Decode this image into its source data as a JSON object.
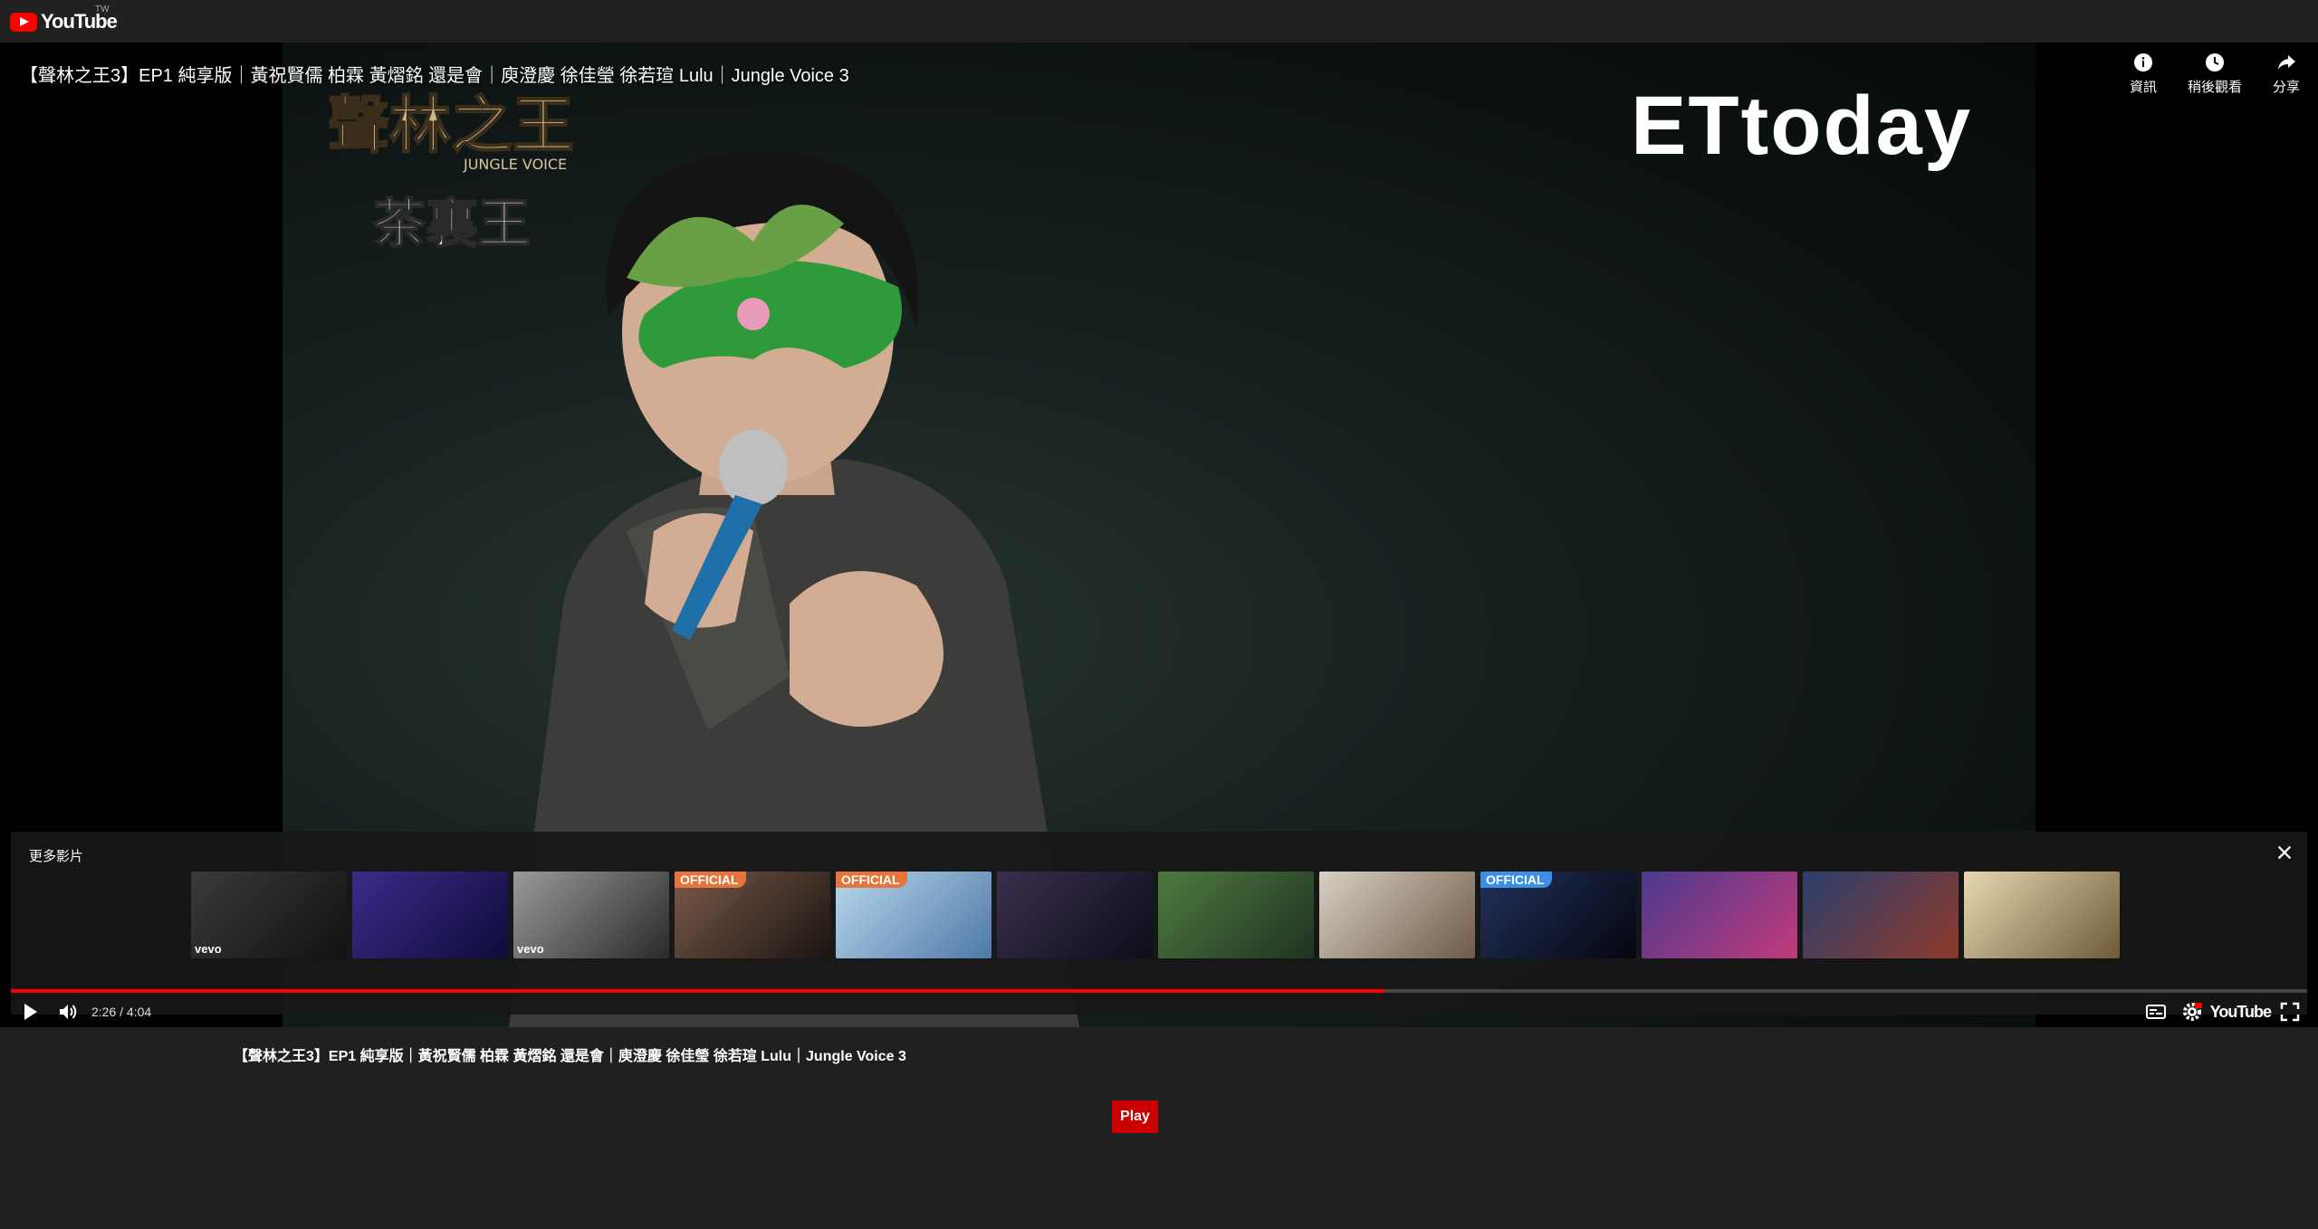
{
  "header": {
    "logo_text": "YouTube",
    "region_code": "TW"
  },
  "player": {
    "title": "【聲林之王3】EP1 純享版｜黃祝賢儒 柏霖 黃熠銘 還是會｜庾澄慶 徐佳瑩 徐若瑄 Lulu｜Jungle Voice 3",
    "actions": [
      {
        "label": "資訊",
        "icon": "info-icon"
      },
      {
        "label": "稍後觀看",
        "icon": "clock-icon"
      },
      {
        "label": "分享",
        "icon": "share-icon"
      }
    ],
    "overlays": {
      "show_logo_line1": "聲林之王",
      "show_logo_sub": "JUNGLE VOICE",
      "sponsor": "茶裏王",
      "brand": "ETtoday"
    },
    "more_videos": {
      "title": "更多影片",
      "thumbnails": [
        {
          "tag": "",
          "vevo": "vevo",
          "colors": [
            "#3a3a3a",
            "#111111"
          ]
        },
        {
          "tag": "",
          "vevo": "",
          "colors": [
            "#3b2c8a",
            "#0f0b3a"
          ]
        },
        {
          "tag": "",
          "vevo": "vevo",
          "colors": [
            "#9a9a9a",
            "#2a2a2a"
          ]
        },
        {
          "tag": "OFFICIAL",
          "vevo": "",
          "colors": [
            "#7a5a4a",
            "#1a1412"
          ]
        },
        {
          "tag": "OFFICIAL",
          "vevo": "",
          "colors": [
            "#b9d8ec",
            "#4e78a8"
          ]
        },
        {
          "tag": "",
          "vevo": "",
          "colors": [
            "#3a2f4e",
            "#0d0d1a"
          ]
        },
        {
          "tag": "",
          "vevo": "",
          "colors": [
            "#4e7a3f",
            "#1f3322"
          ]
        },
        {
          "tag": "",
          "vevo": "",
          "colors": [
            "#d8d0c4",
            "#6e5a48"
          ]
        },
        {
          "tag": "OFFICIAL",
          "vevo": "",
          "colors": [
            "#22305a",
            "#05070f"
          ],
          "tag_style": "blue"
        },
        {
          "tag": "",
          "vevo": "",
          "colors": [
            "#4a3a8e",
            "#c23a7a"
          ]
        },
        {
          "tag": "",
          "vevo": "",
          "colors": [
            "#2a3f6e",
            "#8e3a2a"
          ]
        },
        {
          "tag": "",
          "vevo": "",
          "colors": [
            "#e8d8b0",
            "#6e5a3a"
          ]
        }
      ]
    },
    "progress": {
      "current_time": "2:26",
      "separator": " / ",
      "duration": "4:04",
      "played_fraction": 0.598,
      "buffered_fraction": 0.51
    },
    "controls": {
      "youtube_label": "YouTube"
    }
  },
  "below": {
    "title": "【聲林之王3】EP1 純享版｜黃祝賢儒 柏霖 黃熠銘 還是會｜庾澄慶 徐佳瑩 徐若瑄 Lulu｜Jungle Voice 3",
    "play_label": "Play"
  },
  "colors": {
    "accent_red": "#ff0000",
    "play_button": "#cc0000",
    "page_bg": "#202020"
  }
}
